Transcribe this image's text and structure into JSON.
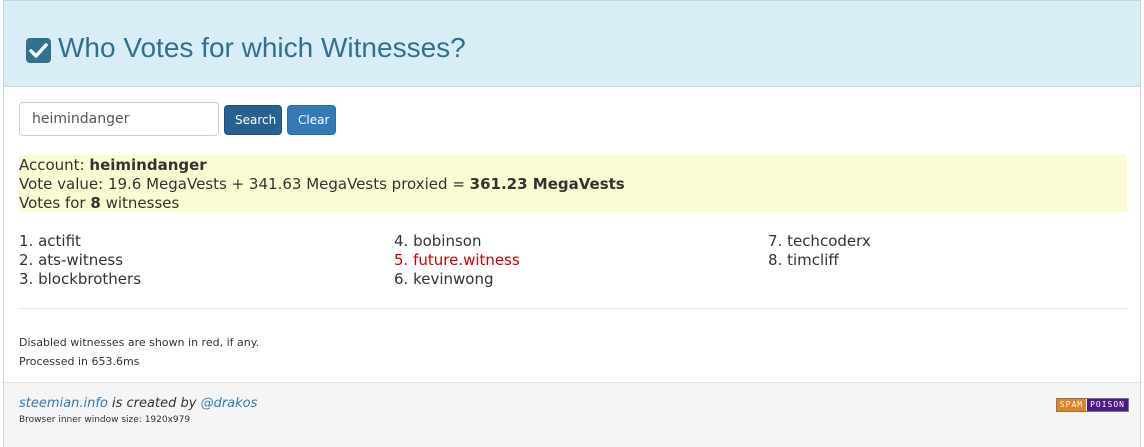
{
  "header": {
    "title": "Who Votes for which Witnesses?"
  },
  "search": {
    "value": "heimindanger",
    "search_label": "Search",
    "clear_label": "Clear"
  },
  "account": {
    "label": "Account:",
    "name": "heimindanger",
    "vote_value_prefix": "Vote value: 19.6 MegaVests + 341.63 MegaVests proxied =",
    "vote_value_total": "361.23 MegaVests",
    "votes_prefix": "Votes for",
    "votes_count": "8",
    "votes_suffix": "witnesses"
  },
  "witnesses": [
    {
      "label": "1. actifit",
      "disabled": false
    },
    {
      "label": "2. ats-witness",
      "disabled": false
    },
    {
      "label": "3. blockbrothers",
      "disabled": false
    },
    {
      "label": "4. bobinson",
      "disabled": false
    },
    {
      "label": "5. future.witness",
      "disabled": true
    },
    {
      "label": "6. kevinwong",
      "disabled": false
    },
    {
      "label": "7. techcoderx",
      "disabled": false
    },
    {
      "label": "8. timcliff",
      "disabled": false
    }
  ],
  "notes": {
    "disabled_note": "Disabled witnesses are shown in red, if any.",
    "processed": "Processed in 653.6ms"
  },
  "footer": {
    "site": "steemian.info",
    "created_by": "is created by",
    "author": "@drakos",
    "window_size": "Browser inner window size: 1920x979"
  },
  "badge": {
    "left": "SPAM",
    "right": "POISON"
  },
  "colors": {
    "header_bg": "#d9edf7",
    "title": "#31708f",
    "disabled": "#cc0000",
    "highlight": "#fcfcd4"
  }
}
